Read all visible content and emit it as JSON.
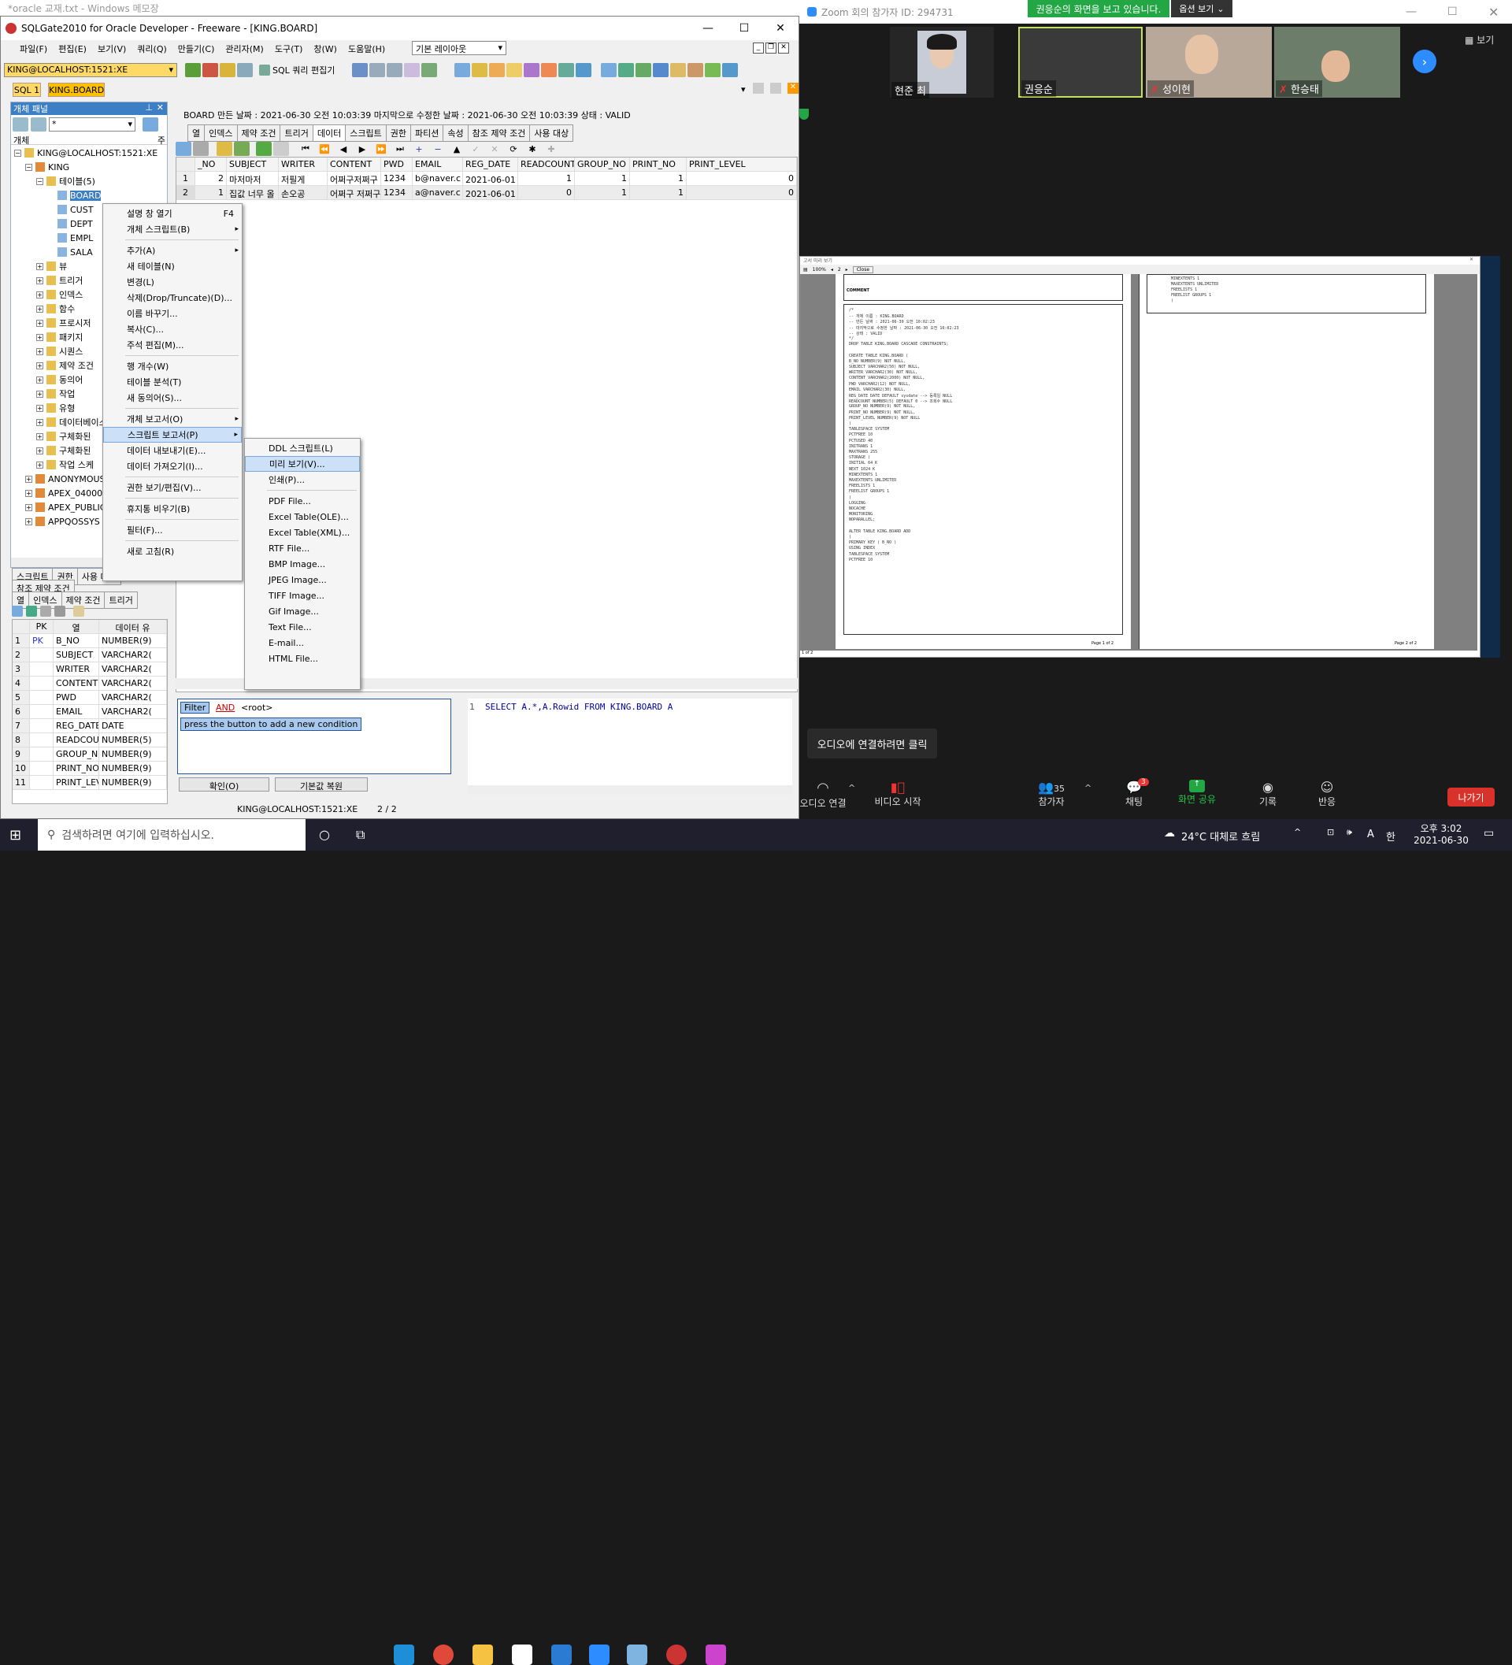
{
  "notepad_title": "*oracle 교재.txt - Windows 메모장",
  "app": {
    "title": "SQLGate2010 for Oracle Developer - Freeware - [KING.BOARD]",
    "menu": [
      "파일(F)",
      "편집(E)",
      "보기(V)",
      "쿼리(Q)",
      "만들기(C)",
      "관리자(M)",
      "도구(T)",
      "창(W)",
      "도움말(H)"
    ],
    "layout_select": "기본 레이아웃",
    "connection": "KING@LOCALHOST:1521:XE",
    "sql_editor_label": "SQL 쿼리 편집기",
    "doc_tabs": [
      "SQL 1",
      "KING.BOARD"
    ]
  },
  "object_panel": {
    "title": "개체 패널",
    "filter_value": "*",
    "col_header": "개체",
    "col_header2": "주",
    "tree": [
      {
        "label": "KING@LOCALHOST:1521:XE",
        "level": 0
      },
      {
        "label": "KING",
        "level": 1
      },
      {
        "label": "테이블(5)",
        "level": 2
      },
      {
        "label": "BOARD",
        "level": 3,
        "selected": true
      },
      {
        "label": "CUST",
        "level": 3
      },
      {
        "label": "DEPT",
        "level": 3
      },
      {
        "label": "EMPL",
        "level": 3
      },
      {
        "label": "SALA",
        "level": 3
      },
      {
        "label": "뷰",
        "level": 2
      },
      {
        "label": "트리거",
        "level": 2
      },
      {
        "label": "인덱스",
        "level": 2
      },
      {
        "label": "함수",
        "level": 2
      },
      {
        "label": "프로시저",
        "level": 2
      },
      {
        "label": "패키지",
        "level": 2
      },
      {
        "label": "시퀀스",
        "level": 2
      },
      {
        "label": "제약 조건",
        "level": 2
      },
      {
        "label": "동의어",
        "level": 2
      },
      {
        "label": "작업",
        "level": 2
      },
      {
        "label": "유형",
        "level": 2
      },
      {
        "label": "데이터베이스",
        "level": 2
      },
      {
        "label": "구체화된",
        "level": 2
      },
      {
        "label": "구체화된",
        "level": 2
      },
      {
        "label": "작업 스케",
        "level": 2
      },
      {
        "label": "ANONYMOUS",
        "level": 1
      },
      {
        "label": "APEX_04000",
        "level": 1
      },
      {
        "label": "APEX_PUBLIC",
        "level": 1
      },
      {
        "label": "APPQOSSYS",
        "level": 1
      }
    ]
  },
  "bottom_left": {
    "tabs1": [
      "스크립트",
      "권한",
      "사용 대상"
    ],
    "tabs2": [
      "참조 제약 조건"
    ],
    "tabs3": [
      "열",
      "인덱스",
      "제약 조건",
      "트리거"
    ],
    "headers": [
      "PK",
      "열",
      "데이터 유"
    ],
    "rows": [
      {
        "n": "1",
        "pk": "PK",
        "col": "B_NO",
        "type": "NUMBER(9)"
      },
      {
        "n": "2",
        "pk": "",
        "col": "SUBJECT",
        "type": "VARCHAR2("
      },
      {
        "n": "3",
        "pk": "",
        "col": "WRITER",
        "type": "VARCHAR2("
      },
      {
        "n": "4",
        "pk": "",
        "col": "CONTENT",
        "type": "VARCHAR2("
      },
      {
        "n": "5",
        "pk": "",
        "col": "PWD",
        "type": "VARCHAR2("
      },
      {
        "n": "6",
        "pk": "",
        "col": "EMAIL",
        "type": "VARCHAR2("
      },
      {
        "n": "7",
        "pk": "",
        "col": "REG_DATE",
        "type": "DATE"
      },
      {
        "n": "8",
        "pk": "",
        "col": "READCOUNT",
        "type": "NUMBER(5)"
      },
      {
        "n": "9",
        "pk": "",
        "col": "GROUP_NO",
        "type": "NUMBER(9)"
      },
      {
        "n": "10",
        "pk": "",
        "col": "PRINT_NO",
        "type": "NUMBER(9)"
      },
      {
        "n": "11",
        "pk": "",
        "col": "PRINT_LEVEL",
        "type": "NUMBER(9)"
      }
    ]
  },
  "main": {
    "info": "BOARD  만든 날짜 : 2021-06-30 오전 10:03:39  마지막으로 수정한 날짜 : 2021-06-30 오전 10:03:39  상태 : VALID",
    "tabs": [
      "열",
      "인덱스",
      "제약 조건",
      "트리거",
      "데이터",
      "스크립트",
      "권한",
      "파티션",
      "속성",
      "참조 제약 조건",
      "사용 대상"
    ],
    "headers": [
      "_NO",
      "SUBJECT",
      "WRITER",
      "CONTENT",
      "PWD",
      "EMAIL",
      "REG_DATE",
      "READCOUNT",
      "GROUP_NO",
      "PRINT_NO",
      "PRINT_LEVEL"
    ],
    "rows": [
      [
        "1",
        "2",
        "마저마저",
        "저필게",
        "어쩌구저쩌구",
        "1234",
        "b@naver.c",
        "2021-06-01 오",
        "1",
        "1",
        "1",
        "0"
      ],
      [
        "2",
        "1",
        "집값 너무 올",
        "손오공",
        "어쩌구 저쩌구",
        "1234",
        "a@naver.c",
        "2021-06-01 오",
        "0",
        "1",
        "1",
        "0"
      ]
    ],
    "filter_label": "Filter",
    "filter_and": "AND",
    "filter_root": "<root>",
    "filter_hint": "press the button to add a new condition",
    "confirm": "확인(O)",
    "reset": "기본값 복원",
    "sql_line": "1",
    "sql": "SELECT A.*,A.Rowid FROM KING.BOARD A",
    "status_conn": "KING@LOCALHOST:1521:XE",
    "status_pos": "2 / 2"
  },
  "context_menu": [
    {
      "label": "설명 창 열기",
      "shortcut": "F4"
    },
    {
      "label": "개체 스크립트(B)",
      "sub": true
    },
    {
      "sep": true
    },
    {
      "label": "추가(A)",
      "sub": true
    },
    {
      "label": "새 테이블(N)"
    },
    {
      "label": "변경(L)"
    },
    {
      "label": "삭제(Drop/Truncate)(D)..."
    },
    {
      "label": "이름 바꾸기..."
    },
    {
      "label": "복사(C)..."
    },
    {
      "label": "주석 편집(M)..."
    },
    {
      "sep": true
    },
    {
      "label": "행 개수(W)"
    },
    {
      "label": "테이블 분석(T)"
    },
    {
      "label": "새 동의어(S)..."
    },
    {
      "sep": true
    },
    {
      "label": "개체 보고서(O)",
      "sub": true
    },
    {
      "label": "스크립트 보고서(P)",
      "sub": true,
      "highlight": true
    },
    {
      "label": "데이터 내보내기(E)..."
    },
    {
      "label": "데이터 가져오기(I)..."
    },
    {
      "sep": true
    },
    {
      "label": "권한 보기/편집(V)..."
    },
    {
      "sep": true
    },
    {
      "label": "휴지통 비우기(B)"
    },
    {
      "sep": true
    },
    {
      "label": "필터(F)..."
    },
    {
      "sep": true
    },
    {
      "label": "새로 고침(R)"
    }
  ],
  "submenu": [
    {
      "label": "DDL 스크립트(L)"
    },
    {
      "label": "미리 보기(V)...",
      "highlight": true
    },
    {
      "label": "인쇄(P)..."
    },
    {
      "sep": true
    },
    {
      "label": "PDF File..."
    },
    {
      "label": "Excel Table(OLE)..."
    },
    {
      "label": "Excel Table(XML)..."
    },
    {
      "label": "RTF File..."
    },
    {
      "label": "BMP Image..."
    },
    {
      "label": "JPEG Image..."
    },
    {
      "label": "TIFF Image..."
    },
    {
      "label": "Gif Image..."
    },
    {
      "label": "Text File..."
    },
    {
      "label": "E-mail..."
    },
    {
      "label": "HTML File..."
    }
  ],
  "zoom": {
    "title": "Zoom 회의 참가자 ID: 294731",
    "share_banner": "권응순의 화면을 보고 있습니다.",
    "view_options": "옵션 보기",
    "view": "보기",
    "participants": [
      "현준 최",
      "권응순",
      "성이현",
      "한승태"
    ],
    "audio_prompt": "오디오에 연결하려면 클릭",
    "controls": [
      "오디오 연결",
      "비디오 시작",
      "참가자",
      "채팅",
      "화면 공유",
      "기록",
      "반응"
    ],
    "participant_count": "35",
    "chat_badge": "3",
    "leave": "나가기"
  },
  "preview": {
    "title": "고서 미리 보기",
    "zoom": "100%",
    "page": "2",
    "close": "Close",
    "page1_footer": "Page 1 of 2",
    "page2_footer": "Page 2 of 2",
    "left_footer": "1 of 2",
    "comment_header": "COMMENT",
    "lines": [
      "/*",
      "-- 개체 이름 : KING.BOARD",
      "-- 만든 날짜 : 2021-06-30 오전 10:02:23",
      "-- 마지막으로 수정한 날짜 : 2021-06-30 오전 10:02:23",
      "-- 상태 : VALID",
      "*/",
      "DROP TABLE KING.BOARD CASCADE CONSTRAINTS;",
      "",
      "CREATE TABLE KING.BOARD (",
      "  B_NO        NUMBER(9)         NOT NULL,",
      "  SUBJECT     VARCHAR2(50)      NOT NULL,",
      "  WRITER      VARCHAR2(30)      NOT NULL,",
      "  CONTENT     VARCHAR2(2000)    NOT NULL,",
      "  PWD         VARCHAR2(12)      NOT NULL,",
      "  EMAIL       VARCHAR2(30)      NULL,",
      "  REG_DATE    DATE   DEFAULT sysdate  --> 등록일    NULL",
      "  READCOUNT   NUMBER(5)  DEFAULT 0    --> 조회수    NULL",
      "  GROUP_NO    NUMBER(9)         NOT NULL,",
      "  PRINT_NO    NUMBER(9)         NOT NULL,",
      "  PRINT_LEVEL NUMBER(9)         NOT NULL",
      ")",
      "TABLESPACE SYSTEM",
      "PCTFREE 10",
      "PCTUSED 40",
      "INITRANS 1",
      "MAXTRANS 255",
      "STORAGE (",
      "  INITIAL 64 K",
      "  NEXT 1024 K",
      "  MINEXTENTS 1",
      "  MAXEXTENTS UNLIMITED",
      "  FREELISTS 1",
      "  FREELIST GROUPS 1",
      ")",
      "LOGGING",
      "NOCACHE",
      "MONITORING",
      "NOPARALLEL;",
      "",
      "ALTER TABLE KING.BOARD ADD",
      "(",
      "  PRIMARY KEY ( B_NO )",
      "    USING INDEX",
      "    TABLESPACE SYSTEM",
      "    PCTFREE 10"
    ],
    "lines2": [
      "MINEXTENTS 1",
      "MAXEXTENTS UNLIMITED",
      "FREELISTS 1",
      "FREELIST GROUPS 1",
      ")"
    ]
  },
  "taskbar": {
    "search": "검색하려면 여기에 입력하십시오.",
    "weather": "24°C  대체로 흐림",
    "ime": "A",
    "ime2": "한",
    "time": "오후 3:02",
    "date": "2021-06-30"
  }
}
